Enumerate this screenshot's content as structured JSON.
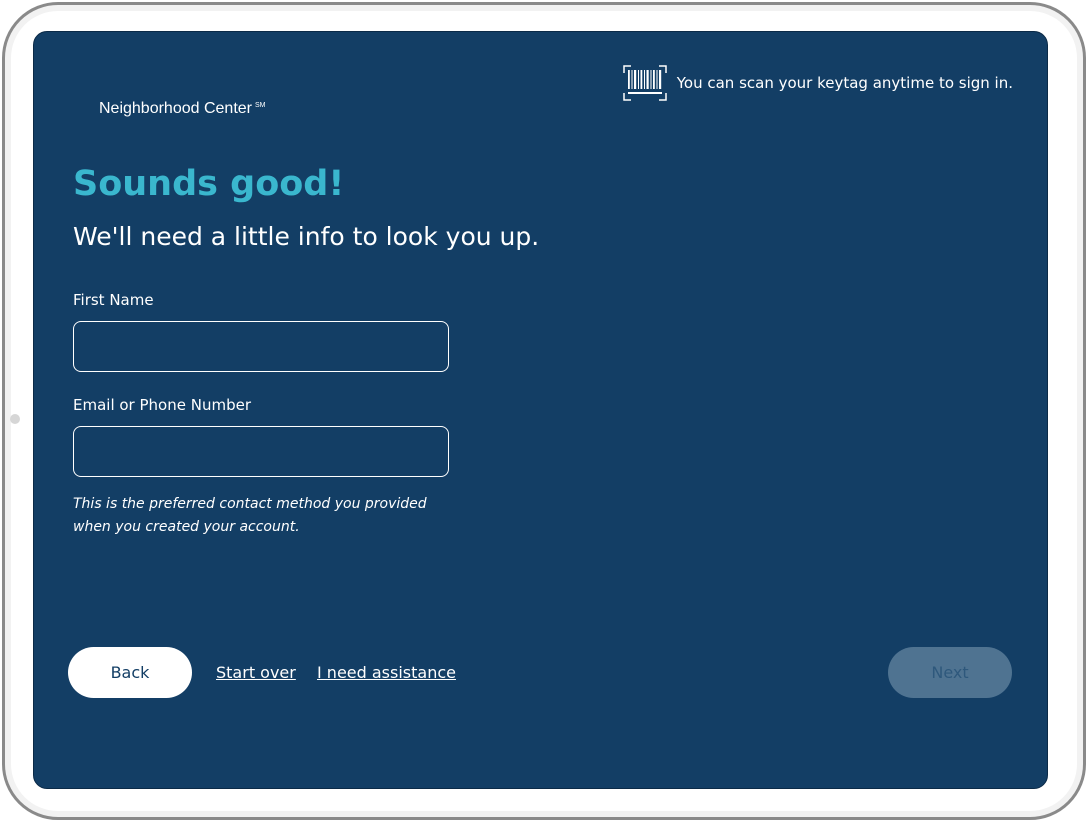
{
  "brand": {
    "name": "Neighborhood Center",
    "mark": "SM"
  },
  "scan_note": {
    "icon": "barcode-icon",
    "text": "You can scan your keytag anytime to sign in."
  },
  "heading": {
    "title": "Sounds good!",
    "subtitle": "We'll need a little info to look you up."
  },
  "form": {
    "first_name": {
      "label": "First Name",
      "value": "",
      "placeholder": ""
    },
    "contact": {
      "label": "Email or Phone Number",
      "value": "",
      "placeholder": ""
    },
    "helper_line1": "This is the preferred contact method you provided",
    "helper_line2": "when you created your account."
  },
  "footer": {
    "back_label": "Back",
    "start_over_label": "Start over",
    "assistance_label": "I need assistance",
    "next_label": "Next",
    "next_enabled": false
  },
  "colors": {
    "screen_background": "#133e65",
    "accent": "#3ab7ce",
    "next_disabled": "#4f7391",
    "text": "#ffffff"
  }
}
